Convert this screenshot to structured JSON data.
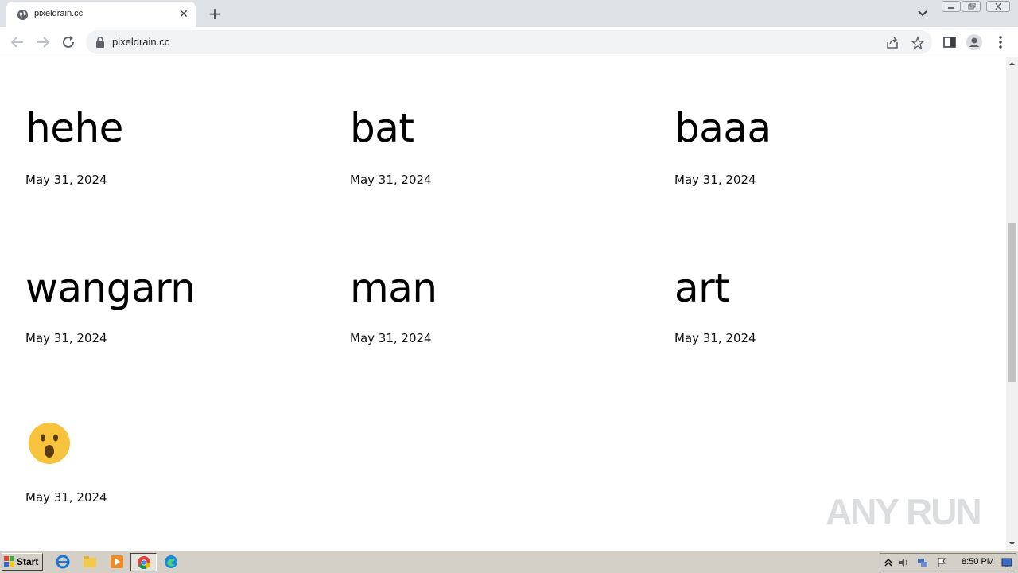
{
  "browser": {
    "tab_title": "pixeldrain.cc",
    "url": "pixeldrain.cc"
  },
  "page": {
    "cards": [
      {
        "name": "hehe",
        "date": "May 31, 2024"
      },
      {
        "name": "bat",
        "date": "May 31, 2024"
      },
      {
        "name": "baaa",
        "date": "May 31, 2024"
      },
      {
        "name": "wangarn",
        "date": "May 31, 2024"
      },
      {
        "name": "man",
        "date": "May 31, 2024"
      },
      {
        "name": "art",
        "date": "May 31, 2024"
      }
    ],
    "emoji_card": {
      "icon": "astonished-face-emoji",
      "date": "May 31, 2024"
    },
    "watermark": "ANY RUN"
  },
  "taskbar": {
    "start_label": "Start",
    "clock": "8:50 PM"
  },
  "colors": {
    "tabstrip": "#dee1e6",
    "omnibox": "#f1f3f4",
    "taskbar": "#d4d0c8",
    "emoji": "#f7c23c"
  }
}
